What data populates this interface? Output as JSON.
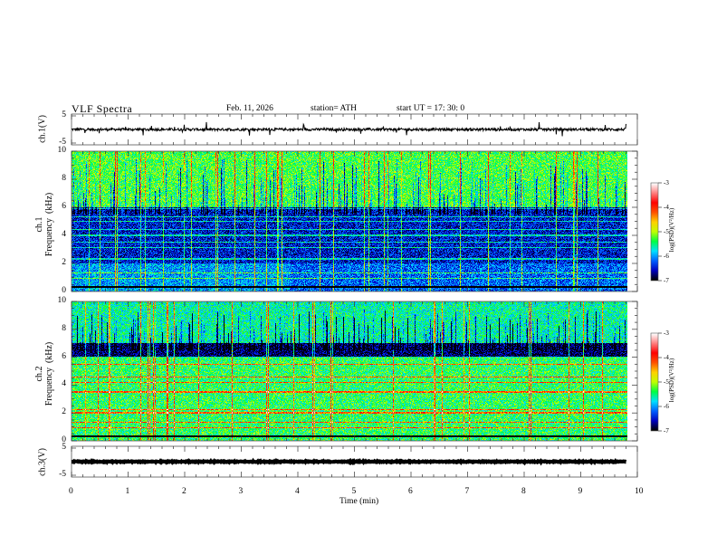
{
  "header": {
    "title": "VLF  Spectra",
    "date": "Feb. 11, 2026",
    "station": "station= ATH",
    "start_ut": "start  UT  =    17: 30: 0"
  },
  "chart_data": [
    {
      "type": "line",
      "panel": "ch1-waveform",
      "ylabel": "ch.1(V)",
      "ylim": [
        -5,
        5
      ],
      "yticks": [
        "5",
        "-5"
      ],
      "xlim": [
        0,
        10
      ],
      "data_end_min": 9.8,
      "baseline_v": 0,
      "typical_amplitude_v": 0.6
    },
    {
      "type": "heatmap",
      "panel": "ch1-spectrogram",
      "ylabel": "ch.1\nFrequency  (kHz)",
      "ylim": [
        0,
        10
      ],
      "yticks": [
        "0",
        "2",
        "4",
        "6",
        "8",
        "10"
      ],
      "xlim": [
        0,
        10
      ],
      "data_end_min": 9.8,
      "colorbar": {
        "label": "log(PSD)(V²/Hz)",
        "range": [
          -7,
          -3
        ],
        "ticks": [
          "-3",
          "-4",
          "-5",
          "-6",
          "-7"
        ]
      },
      "background_levels": [
        {
          "band_khz": [
            6,
            10
          ],
          "log_psd": -5.3
        },
        {
          "band_khz": [
            2,
            6
          ],
          "log_psd": -6.5
        },
        {
          "band_khz": [
            0,
            2
          ],
          "log_psd": -6.0
        }
      ],
      "narrowband_lines_khz": [
        0.3,
        0.9,
        1.3,
        2.3,
        3.1,
        3.5,
        4.0,
        4.4,
        5.0,
        5.3,
        5.9
      ]
    },
    {
      "type": "heatmap",
      "panel": "ch2-spectrogram",
      "ylabel": "ch.2\nFrequency  (kHz)",
      "ylim": [
        0,
        10
      ],
      "yticks": [
        "0",
        "2",
        "4",
        "6",
        "8",
        "10"
      ],
      "xlim": [
        0,
        10
      ],
      "data_end_min": 9.8,
      "colorbar": {
        "label": "log(PSD)(V²/Hz)",
        "range": [
          -7,
          -3
        ],
        "ticks": [
          "-3",
          "-4",
          "-5",
          "-6",
          "-7"
        ]
      },
      "background_levels": [
        {
          "band_khz": [
            7,
            10
          ],
          "log_psd": -5.6
        },
        {
          "band_khz": [
            6,
            7
          ],
          "log_psd": -6.8
        },
        {
          "band_khz": [
            0,
            6
          ],
          "log_psd": -5.4
        }
      ],
      "narrowband_lines_khz": [
        0.3,
        0.9,
        1.3,
        2.0,
        2.2,
        3.5,
        4.2,
        4.6,
        5.5,
        6.0
      ]
    },
    {
      "type": "line",
      "panel": "ch3-waveform",
      "ylabel": "ch.3(V)",
      "ylim": [
        -5,
        5
      ],
      "yticks": [
        "5",
        "-5"
      ],
      "xlim": [
        0,
        10
      ],
      "data_end_min": 9.8,
      "baseline_v": 0,
      "typical_amplitude_v": 0.2
    }
  ],
  "xaxis": {
    "label": "Time  (min)",
    "ticks": [
      "0",
      "1",
      "2",
      "3",
      "4",
      "5",
      "6",
      "7",
      "8",
      "9",
      "10"
    ]
  },
  "colors": {
    "colormap": [
      "#000000",
      "#0000c0",
      "#0060ff",
      "#00e0ff",
      "#00ff40",
      "#c0ff00",
      "#ffd000",
      "#ff5000",
      "#ff0000",
      "#ff8080",
      "#ffffff"
    ]
  }
}
